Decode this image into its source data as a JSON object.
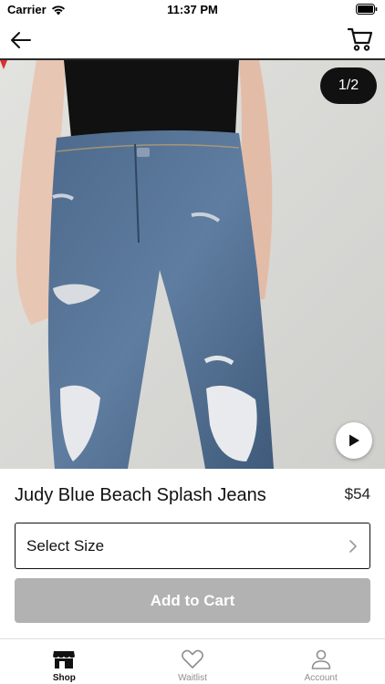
{
  "status_bar": {
    "carrier": "Carrier",
    "time": "11:37 PM"
  },
  "nav": {
    "back_icon": "arrow-left-icon",
    "cart_icon": "cart-icon"
  },
  "gallery": {
    "counter": "1/2",
    "current_index": 1,
    "total": 2,
    "play_icon": "play-icon"
  },
  "product": {
    "title": "Judy Blue Beach Splash Jeans",
    "price": "$54"
  },
  "size_select": {
    "label": "Select Size",
    "icon": "chevron-right-icon"
  },
  "add_to_cart": {
    "label": "Add to Cart",
    "enabled": false,
    "color": "#b2b2b2"
  },
  "tabs": [
    {
      "label": "Shop",
      "icon": "storefront-icon",
      "active": true
    },
    {
      "label": "Waitlist",
      "icon": "heart-icon",
      "active": false
    },
    {
      "label": "Account",
      "icon": "person-icon",
      "active": false
    }
  ],
  "colors": {
    "accent": "#111111",
    "disabled_button": "#b2b2b2",
    "inactive_tab": "#8e8e8e"
  }
}
